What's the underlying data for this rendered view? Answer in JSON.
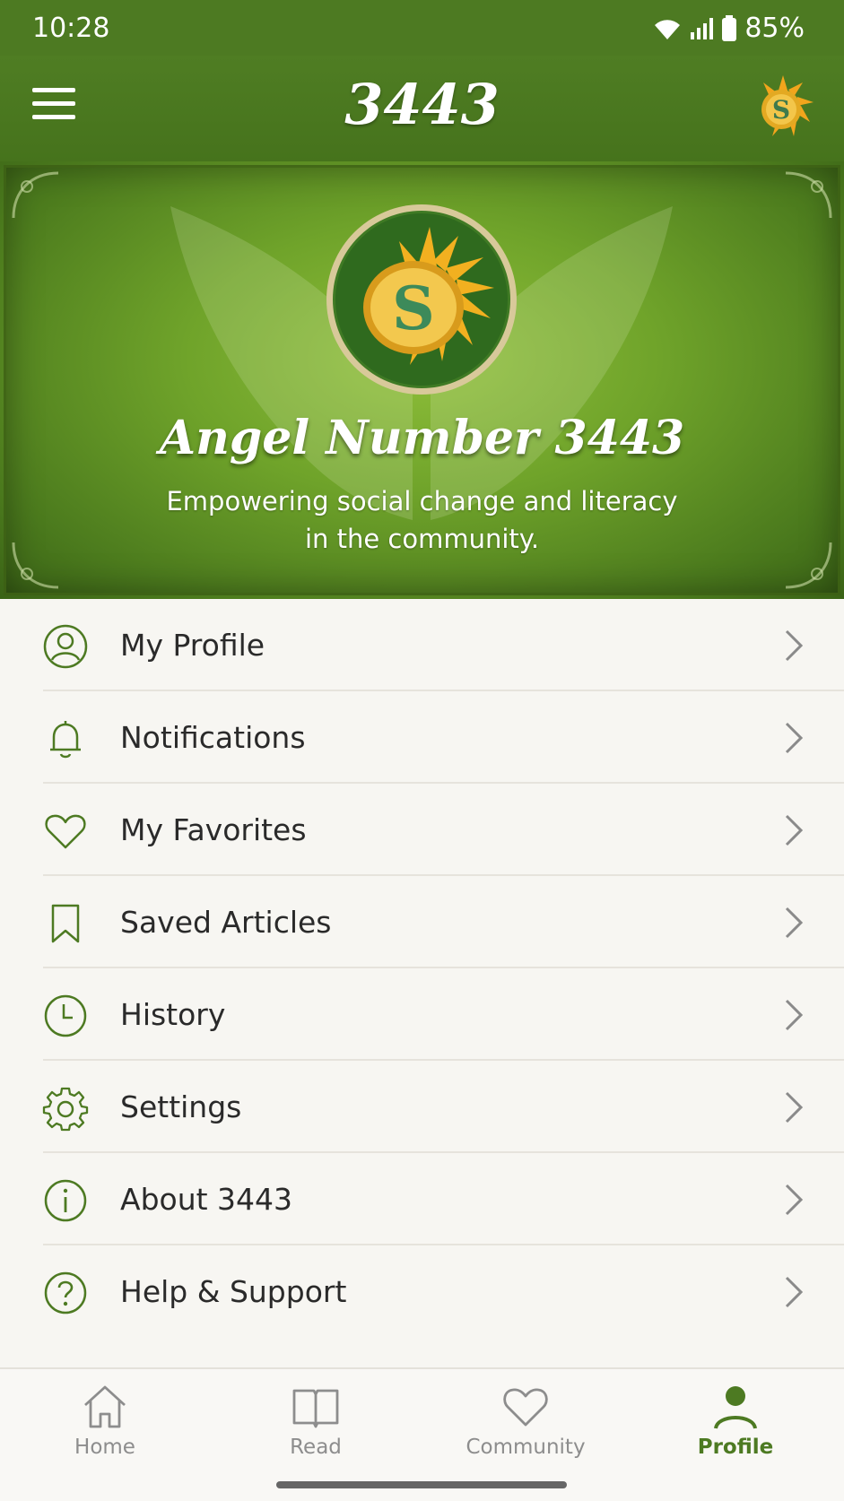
{
  "status_bar": {
    "time": "10:28",
    "battery": "85%"
  },
  "app_bar": {
    "title": "3443"
  },
  "hero": {
    "title": "Angel Number 3443",
    "subtitle": "Empowering social change and literacy in the community."
  },
  "menu": {
    "items": [
      {
        "label": "My Profile",
        "icon": "user-circle-icon"
      },
      {
        "label": "Notifications",
        "icon": "bell-icon"
      },
      {
        "label": "My Favorites",
        "icon": "heart-icon"
      },
      {
        "label": "Saved Articles",
        "icon": "bookmark-icon"
      },
      {
        "label": "History",
        "icon": "clock-icon"
      },
      {
        "label": "Settings",
        "icon": "gear-icon"
      },
      {
        "label": "About 3443",
        "icon": "info-icon"
      },
      {
        "label": "Help & Support",
        "icon": "question-icon"
      }
    ]
  },
  "tabs": [
    {
      "label": "Home",
      "icon": "home-icon"
    },
    {
      "label": "Read",
      "icon": "book-icon"
    },
    {
      "label": "Community",
      "icon": "heart-icon"
    },
    {
      "label": "Profile",
      "icon": "person-icon",
      "active": true
    }
  ],
  "colors": {
    "primary_green": "#4d7a22",
    "icon_green": "#4d7a22",
    "background": "#f7f6f2",
    "inactive_gray": "#8d8d8d"
  }
}
